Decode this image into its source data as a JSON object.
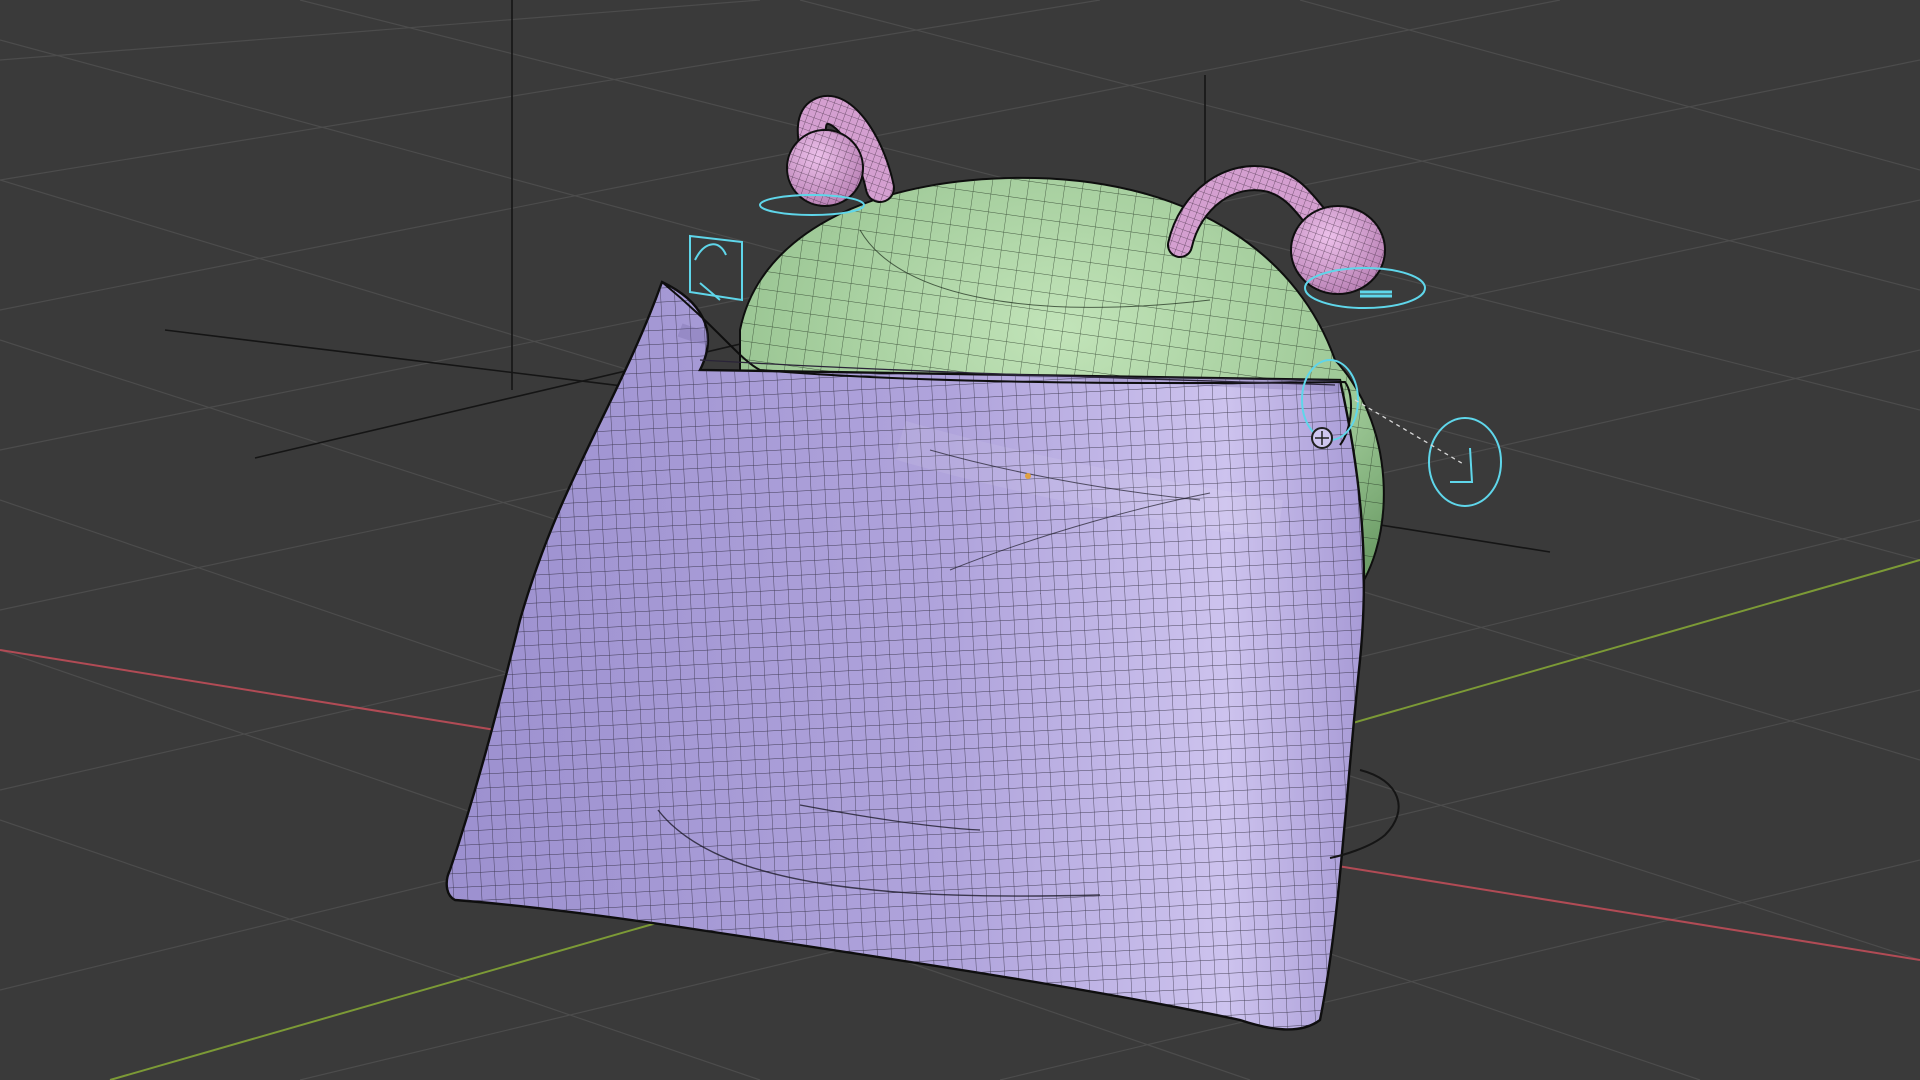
{
  "viewport": {
    "mode": "3d-viewport",
    "shading": "solid",
    "overlays": [
      "wireframe",
      "floor-grid",
      "axes"
    ]
  },
  "colors": {
    "background": "#3a3a3a",
    "grid": "#4a4a4a",
    "x_axis": "#b14b55",
    "y_axis": "#7c9a36",
    "cloth": "#ab9ed8",
    "head": "#a9d0a1",
    "antenna": "#d9a5d6",
    "empty_gizmo": "#5fd6ea"
  },
  "objects": [
    {
      "name": "cloth-sheet",
      "color": "cloth",
      "selected": false
    },
    {
      "name": "head-sphere",
      "color": "head",
      "selected": false
    },
    {
      "name": "antenna-left",
      "color": "antenna",
      "selected": false
    },
    {
      "name": "antenna-right",
      "color": "antenna",
      "selected": false
    }
  ],
  "empties": [
    "empty-left",
    "empty-right",
    "empty-front"
  ]
}
